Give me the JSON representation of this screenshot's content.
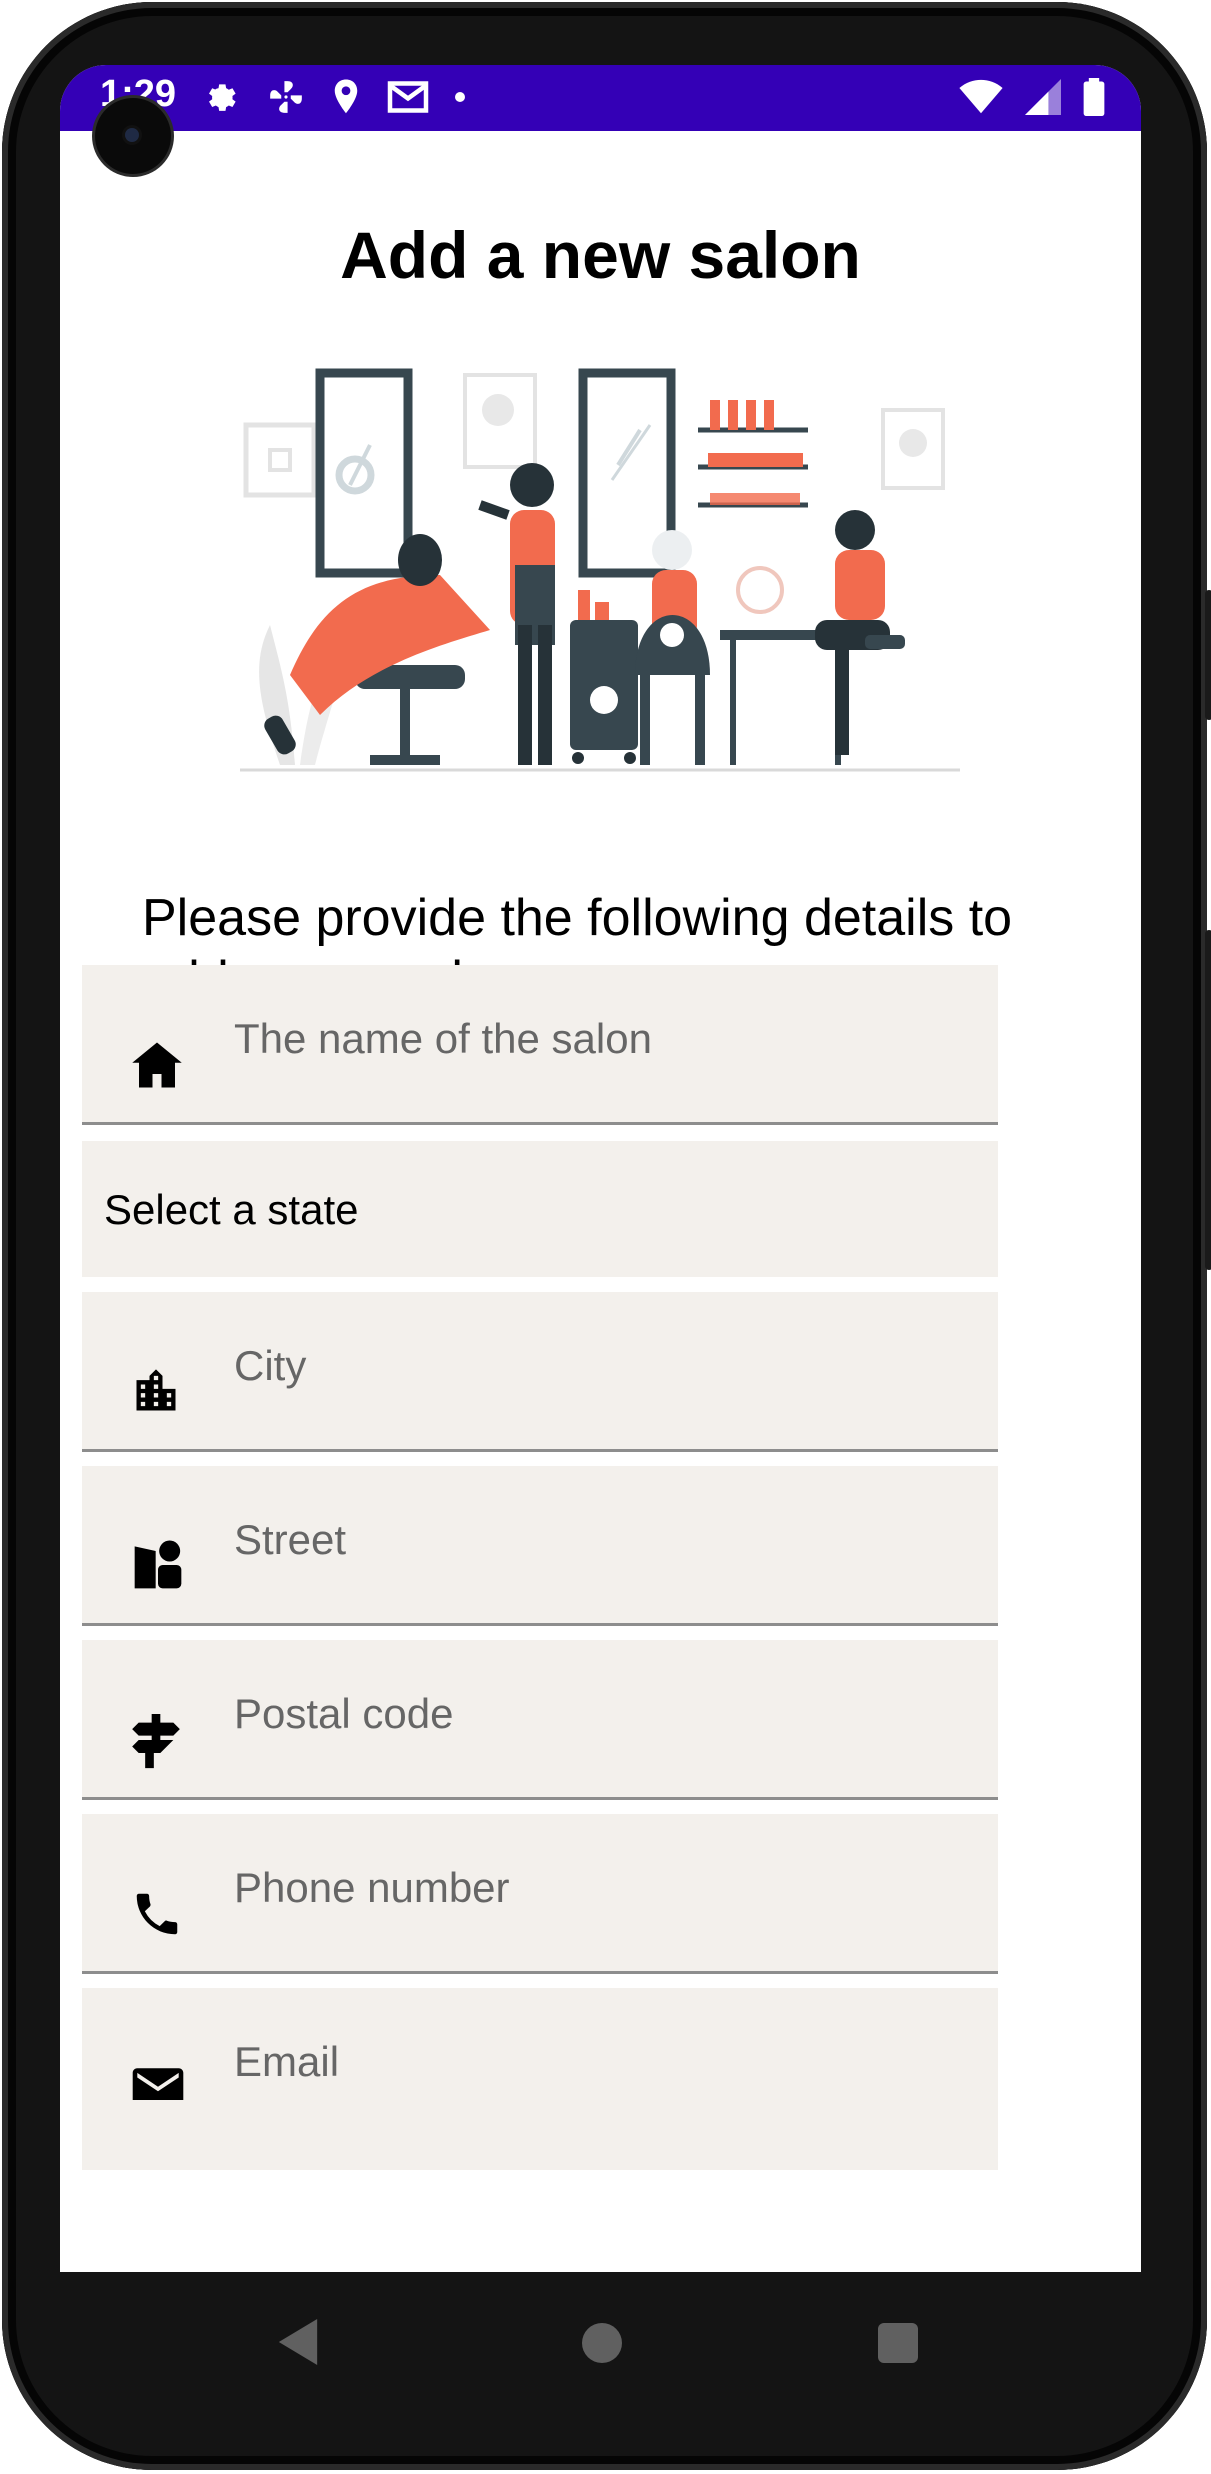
{
  "status_bar": {
    "time": "1:29",
    "icons": [
      "settings-icon",
      "fan-icon",
      "location-icon",
      "gmail-icon",
      "dot-icon"
    ],
    "right_icons": [
      "wifi-icon",
      "signal-icon",
      "battery-icon"
    ],
    "color": "#3400b6"
  },
  "header": {
    "title": "Add a new salon"
  },
  "intro_text": "Please provide the following details to add a new salon:",
  "form": {
    "name_placeholder": "The name of the salon",
    "state_label": "Select a state",
    "city_placeholder": "City",
    "street_placeholder": "Street",
    "postal_placeholder": "Postal code",
    "phone_placeholder": "Phone number",
    "email_placeholder": "Email"
  },
  "colors": {
    "accent": "#f26b4e",
    "dark": "#37474f",
    "field_bg": "#f3f0ec"
  }
}
